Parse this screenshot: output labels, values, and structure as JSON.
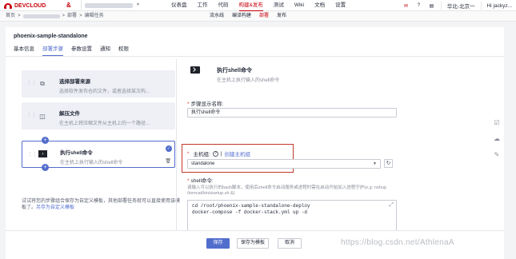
{
  "app": {
    "brand": "DEVCLOUD",
    "project_icon": "&"
  },
  "top_nav": [
    "仪表盘",
    "工作",
    "代码",
    "构建&发布",
    "测试",
    "Wiki",
    "文档",
    "设置"
  ],
  "top_nav_active": "构建&发布",
  "top_right": {
    "region": "华北-北京一",
    "user": "Hi jackyz..."
  },
  "breadcrumb": {
    "home": "首页",
    "sep": ">",
    "parent": "部署",
    "current": "编辑任务"
  },
  "sub_nav": [
    "流水线",
    "编译构建",
    "部署",
    "发布"
  ],
  "sub_nav_active": "部署",
  "page": {
    "title": "phoenix-sample-standalone"
  },
  "tabs": [
    "基本信息",
    "部署步骤",
    "参数设置",
    "通知",
    "权限"
  ],
  "tabs_active": "部署步骤",
  "steps": [
    {
      "title": "选择部署来源",
      "desc": "选择软件发布仓的文件，或者选择某次构...",
      "icon": "deploy-source-icon"
    },
    {
      "title": "解压文件",
      "desc": "在主机上将压缩文件从主机上的一个路径...",
      "icon": "unzip-icon"
    },
    {
      "title": "执行shell命令",
      "desc": "在主机上执行输入的shell命令",
      "icon": "terminal-icon"
    }
  ],
  "hint": {
    "text": "试试将您的步骤组合保存为自定义模板，其他部署任务就可以直接使用该模板了。",
    "link": "另存为自定义模板"
  },
  "detail": {
    "title": "执行shell命令",
    "desc": "在主机上执行输入的shell命令",
    "step_name_label": "步骤显示名称:",
    "step_name_value": "执行shell命令",
    "host_label": "主机组:",
    "host_help": "?",
    "host_sep": "|",
    "create_host_link": "创建主机组",
    "host_value": "standalone",
    "shell_label": "shell命令:",
    "shell_help": "请输入可以执行的bash脚本，使用后shell命令启动服务或进程时需在启动开始加入进程守护(e.g: nohup /tomcat/bin/startup.sh &)",
    "shell_lines": [
      "cd /root/phoenix-sample-standalone-deploy",
      "docker-compose -f docker-stack.yml up -d"
    ]
  },
  "buttons": {
    "save": "保存",
    "save_template": "保存为模板",
    "cancel": "取消"
  },
  "watermark": "https://blog.csdn.net/AthlenaA"
}
